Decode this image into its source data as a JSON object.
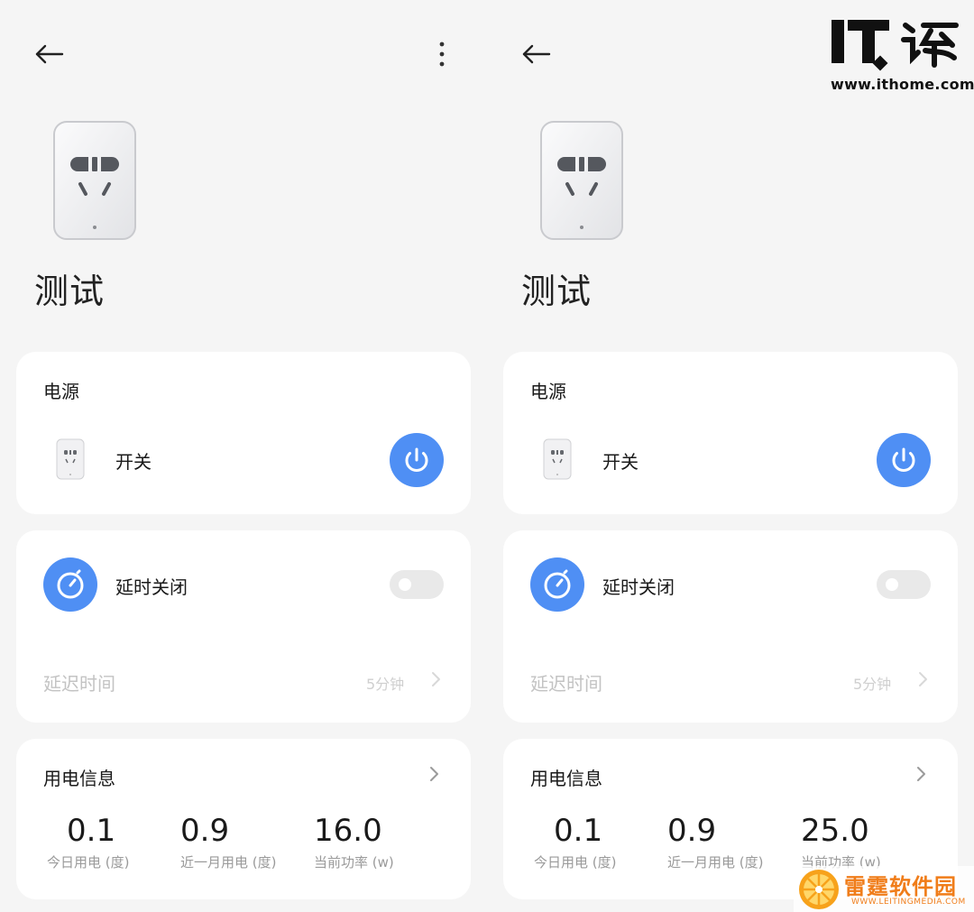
{
  "device": {
    "name": "测试"
  },
  "power": {
    "title": "电源",
    "switch_label": "开关"
  },
  "timer": {
    "label": "延时关闭",
    "enabled": false,
    "delay_label": "延迟时间",
    "delay_value": "5分钟"
  },
  "energy_left": {
    "title": "用电信息",
    "today_value": "0.1",
    "today_label": "今日用电 (度)",
    "month_value": "0.9",
    "month_label": "近一月用电 (度)",
    "power_value": "16.0",
    "power_label": "当前功率 (w)"
  },
  "energy_right": {
    "title": "用电信息",
    "today_value": "0.1",
    "today_label": "今日用电 (度)",
    "month_value": "0.9",
    "month_label": "近一月用电 (度)",
    "power_value": "25.0",
    "power_label": "当前功率 (w)"
  },
  "watermarks": {
    "ithome_url": "www.ithome.com",
    "leiting_name": "雷霆软件园",
    "leiting_url": "WWW.LEITINGMEDIA.COM"
  },
  "colors": {
    "accent": "#4f8ff4",
    "background": "#f5f5f5",
    "card": "#ffffff"
  },
  "icons": {
    "back": "arrow-left-icon",
    "more": "more-vertical-icon",
    "power": "power-icon",
    "timer": "timer-icon",
    "chevron": "chevron-right-icon"
  }
}
